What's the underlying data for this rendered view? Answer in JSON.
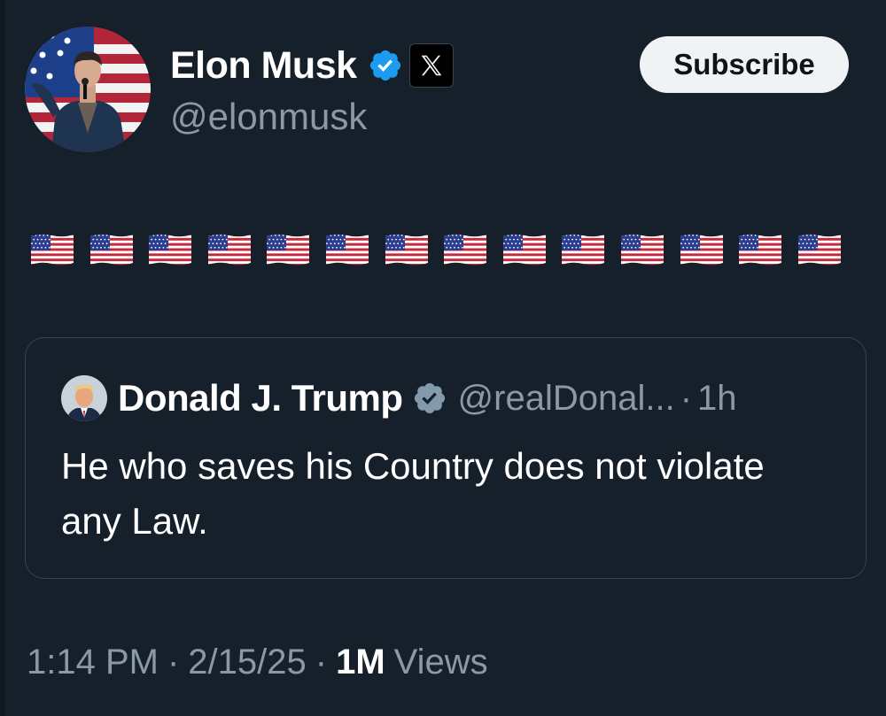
{
  "author": {
    "display_name": "Elon Musk",
    "handle": "@elonmusk",
    "verified": true,
    "affiliate_badge": "x-logo-icon",
    "avatar": "avatar-photo-american-flag-background"
  },
  "subscribe_button": {
    "label": "Subscribe"
  },
  "post": {
    "content_emoji": "🇺🇸🇺🇸🇺🇸🇺🇸🇺🇸🇺🇸🇺🇸🇺🇸🇺🇸🇺🇸🇺🇸🇺🇸🇺🇸🇺🇸",
    "flag_count": 14
  },
  "quoted_post": {
    "display_name": "Donald J. Trump",
    "handle": "@realDonal...",
    "separator": "·",
    "time": "1h",
    "verified": true,
    "text": "He who saves his Country does not violate any Law."
  },
  "meta": {
    "time": "1:14 PM",
    "separator": "·",
    "date": "2/15/25",
    "views_count": "1M",
    "views_label": "Views"
  },
  "colors": {
    "background": "#15202b",
    "border": "#38444d",
    "secondary_text": "#8b98a5",
    "primary_text": "#ffffff",
    "verified_blue": "#1d9bf0",
    "verified_gray": "#829aab",
    "subscribe_bg": "#eff3f4"
  }
}
